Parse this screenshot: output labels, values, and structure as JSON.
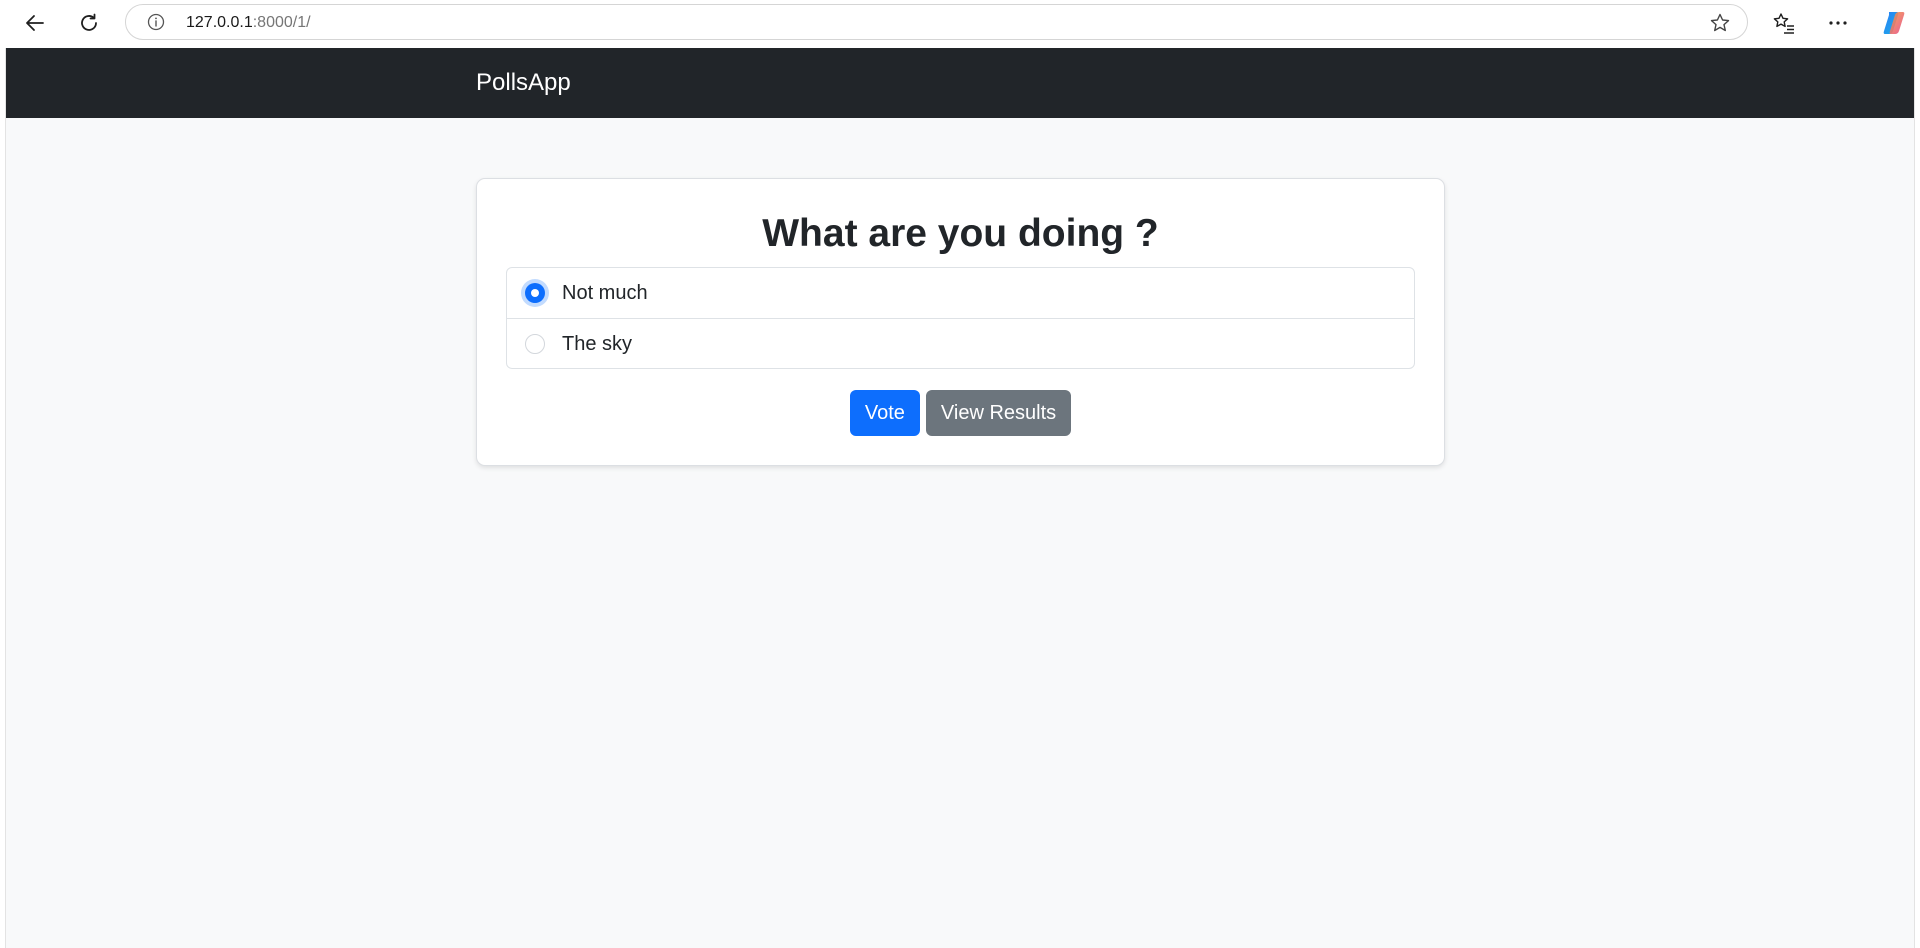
{
  "browser": {
    "url_host": "127.0.0.1",
    "url_rest": ":8000/1/",
    "icons": {
      "back": "back-arrow-icon",
      "reload": "reload-icon",
      "info": "info-icon",
      "favorite": "star-icon",
      "favorites_list": "favorites-list-icon",
      "menu": "more-options-icon",
      "copilot": "copilot-icon"
    }
  },
  "navbar": {
    "brand": "PollsApp"
  },
  "poll": {
    "question": "What are you doing ?",
    "choices": [
      {
        "label": "Not much",
        "checked": true
      },
      {
        "label": "The sky",
        "checked": false
      }
    ],
    "vote_label": "Vote",
    "results_label": "View Results"
  },
  "colors": {
    "navbar_bg": "#212529",
    "page_bg": "#f8f9fa",
    "primary": "#0d6efd",
    "secondary": "#6c757d"
  }
}
